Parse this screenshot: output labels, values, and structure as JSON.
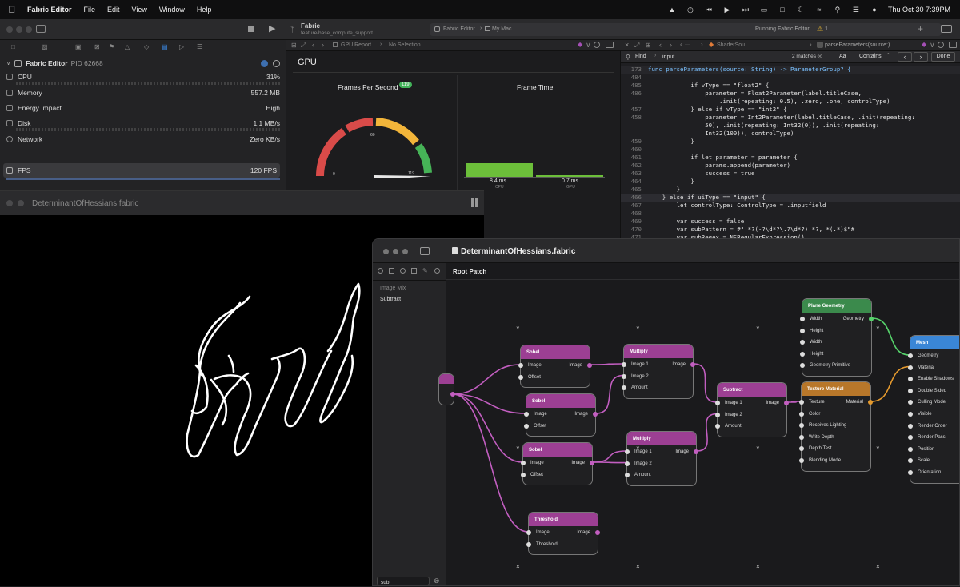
{
  "menubar": {
    "app": "Fabric Editor",
    "items": [
      "File",
      "Edit",
      "View",
      "Window",
      "Help"
    ],
    "clock": "Thu Oct 30  7:39PM"
  },
  "xcode": {
    "scheme_name": "Fabric",
    "branch": "feature/base_compute_support",
    "destination_app": "Fabric Editor",
    "destination_device": "My Mac",
    "status": "Running Fabric Editor",
    "warnings": "1",
    "breadcrumb_report": "GPU Report",
    "breadcrumb_selection": "No Selection",
    "code_tab_file": "ShaderSou...",
    "code_tab_func": "parseParameters(source:)",
    "process": {
      "name": "Fabric Editor",
      "pid": "PID 62668"
    },
    "gauges": [
      {
        "label": "CPU",
        "value": "31%"
      },
      {
        "label": "Memory",
        "value": "557.2 MB"
      },
      {
        "label": "Energy Impact",
        "value": "High"
      },
      {
        "label": "Disk",
        "value": "1.1 MB/s"
      },
      {
        "label": "Network",
        "value": "Zero KB/s"
      },
      {
        "label": "FPS",
        "value": "120 FPS"
      }
    ],
    "gpu_report": {
      "heading": "GPU",
      "fps_title": "Frames Per Second",
      "fps_badge": "119",
      "fps_value": 119,
      "fps_max": 120,
      "tick_0": "0",
      "tick_60": "60",
      "tick_120": "119",
      "frame_time_title": "Frame Time",
      "cpu_ms": "8.4 ms",
      "cpu_label": "CPU",
      "gpu_ms": "0.7 ms",
      "gpu_label": "GPU"
    },
    "find": {
      "label": "Find",
      "query": "input",
      "matches": "2 matches",
      "mode": "Contains",
      "case_btn": "Aa",
      "done": "Done"
    },
    "code_lines": [
      {
        "n": "173",
        "t": "func parseParameters(source: String) -> ParameterGroup? {"
      },
      {
        "n": "484",
        "t": ""
      },
      {
        "n": "485",
        "t": "            if vType == \"float2\" {"
      },
      {
        "n": "486",
        "t": "                parameter = Float2Parameter(label.titleCase,"
      },
      {
        "n": "",
        "t": "                    .init(repeating: 0.5), .zero, .one, controlType)"
      },
      {
        "n": "457",
        "t": "            } else if vType == \"int2\" {"
      },
      {
        "n": "458",
        "t": "                parameter = Int2Parameter(label.titleCase, .init(repeating:"
      },
      {
        "n": "",
        "t": "                50), .init(repeating: Int32(0)), .init(repeating:"
      },
      {
        "n": "",
        "t": "                Int32(100)), controlType)"
      },
      {
        "n": "459",
        "t": "            }"
      },
      {
        "n": "460",
        "t": ""
      },
      {
        "n": "461",
        "t": "            if let parameter = parameter {"
      },
      {
        "n": "462",
        "t": "                params.append(parameter)"
      },
      {
        "n": "463",
        "t": "                success = true"
      },
      {
        "n": "464",
        "t": "            }"
      },
      {
        "n": "465",
        "t": "        }"
      },
      {
        "n": "466",
        "t": "    } else if uiType == \"input\" {"
      },
      {
        "n": "467",
        "t": "        let controlType: ControlType = .inputfield"
      },
      {
        "n": "468",
        "t": ""
      },
      {
        "n": "469",
        "t": "        var success = false"
      },
      {
        "n": "470",
        "t": "        var subPattern = #\" *?(-?\\d*?\\.?\\d*?) *?, *(.*)$\"#"
      },
      {
        "n": "471",
        "t": "        var subRegex = NSRegularExpression()"
      }
    ]
  },
  "viewer": {
    "title": "DeterminantOfHessians.fabric"
  },
  "editor": {
    "title": "DeterminantOfHessians.fabric",
    "breadcrumb": "Root Patch",
    "sidebar_section": "Image Mix",
    "sidebar_item": "Subtract",
    "search_value": "sub",
    "nodes": [
      {
        "id": "sobel1",
        "title": "Sobel",
        "inputs": [
          "Image",
          "Offset"
        ],
        "outputs": [
          "Image"
        ]
      },
      {
        "id": "sobel2",
        "title": "Sobel",
        "inputs": [
          "Image",
          "Offset"
        ],
        "outputs": [
          "Image"
        ]
      },
      {
        "id": "sobel3",
        "title": "Sobel",
        "inputs": [
          "Image",
          "Offset"
        ],
        "outputs": [
          "Image"
        ]
      },
      {
        "id": "threshold",
        "title": "Threshold",
        "inputs": [
          "Image",
          "Threshold"
        ],
        "outputs": [
          "Image"
        ]
      },
      {
        "id": "multiply1",
        "title": "Multiply",
        "inputs": [
          "Image 1",
          "Image 2",
          "Amount"
        ],
        "outputs": [
          "Image"
        ]
      },
      {
        "id": "multiply2",
        "title": "Multiply",
        "inputs": [
          "Image 1",
          "Image 2",
          "Amount"
        ],
        "outputs": [
          "Image"
        ]
      },
      {
        "id": "subtract",
        "title": "Subtract",
        "inputs": [
          "Image 1",
          "Image 2",
          "Amount"
        ],
        "outputs": [
          "Image"
        ]
      },
      {
        "id": "plane",
        "title": "Plane Geometry",
        "inputs": [
          "Width",
          "Height",
          "Width",
          "Height",
          "Geometry Primitive"
        ],
        "outputs": [
          "Geometry"
        ]
      },
      {
        "id": "texmat",
        "title": "Texture Material",
        "inputs": [
          "Texture",
          "Color",
          "Receives Lighting",
          "Write Depth",
          "Depth Test",
          "Blending Mode"
        ],
        "outputs": [
          "Material"
        ]
      },
      {
        "id": "mesh",
        "title": "Mesh",
        "inputs": [
          "Geometry",
          "Material",
          "Enable Shadows",
          "Double Sided",
          "Culling Mode",
          "Visible",
          "Render Order",
          "Render Pass",
          "Position",
          "Scale",
          "Orientation"
        ],
        "outputs": []
      }
    ]
  },
  "colors": {
    "purple_header": "#9c3f93",
    "green_header": "#3b8a4c",
    "orange_header": "#b8772a",
    "blue_header": "#3a86d6",
    "wire_purple": "#c25ec0",
    "wire_green": "#56d36b",
    "wire_orange": "#e59a2e"
  }
}
